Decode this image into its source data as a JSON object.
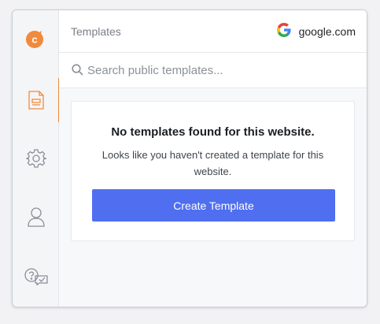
{
  "colors": {
    "accent": "#4f6ff0",
    "brand_orange": "#f08a3c",
    "sidebar_bg": "#f4f5f7"
  },
  "sidebar": {
    "logo_letter": "c",
    "items": [
      {
        "icon": "template-icon",
        "active": true
      },
      {
        "icon": "gear-icon",
        "active": false
      },
      {
        "icon": "user-icon",
        "active": false
      },
      {
        "icon": "help-chat-icon",
        "active": false
      }
    ]
  },
  "header": {
    "title": "Templates",
    "site_icon": "google-icon",
    "domain": "google.com"
  },
  "search": {
    "placeholder": "Search public templates...",
    "value": ""
  },
  "empty_state": {
    "title": "No templates found for this website.",
    "message": "Looks like you haven't created a template for this website.",
    "button_label": "Create Template"
  }
}
